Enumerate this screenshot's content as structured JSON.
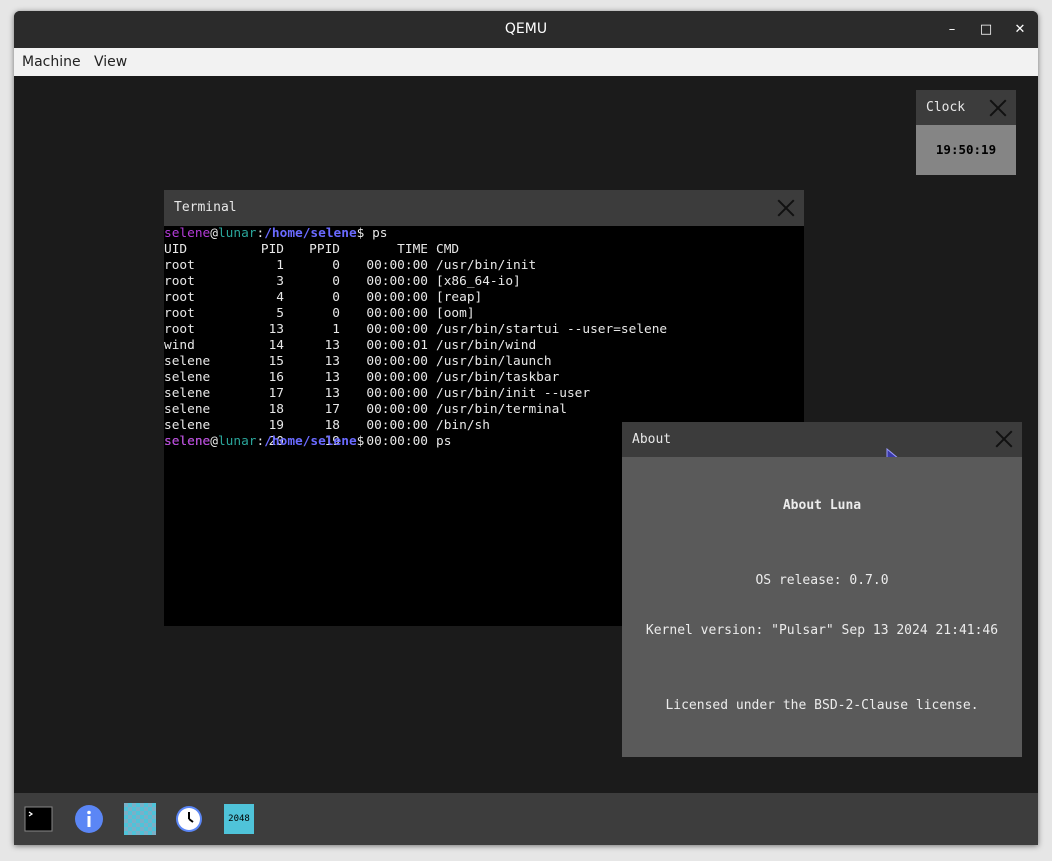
{
  "window": {
    "title": "QEMU",
    "minimize_label": "–",
    "maximize_label": "□",
    "close_label": "✕"
  },
  "menubar": {
    "items": [
      "Machine",
      "View"
    ]
  },
  "clock": {
    "title": "Clock",
    "time": "19:50:19"
  },
  "terminal": {
    "title": "Terminal",
    "prompt": {
      "user": "selene",
      "at": "@",
      "host": "lunar",
      "colon": ":",
      "path": "/home/selene",
      "symbol": "$"
    },
    "command": " ps",
    "columns": [
      "UID",
      "PID",
      "PPID",
      "TIME",
      "CMD"
    ],
    "rows": [
      [
        "root",
        "1",
        "0",
        "00:00:00",
        "/usr/bin/init"
      ],
      [
        "root",
        "3",
        "0",
        "00:00:00",
        "[x86_64-io]"
      ],
      [
        "root",
        "4",
        "0",
        "00:00:00",
        "[reap]"
      ],
      [
        "root",
        "5",
        "0",
        "00:00:00",
        "[oom]"
      ],
      [
        "root",
        "13",
        "1",
        "00:00:00",
        "/usr/bin/startui --user=selene"
      ],
      [
        "wind",
        "14",
        "13",
        "00:00:01",
        "/usr/bin/wind"
      ],
      [
        "selene",
        "15",
        "13",
        "00:00:00",
        "/usr/bin/launch"
      ],
      [
        "selene",
        "16",
        "13",
        "00:00:00",
        "/usr/bin/taskbar"
      ],
      [
        "selene",
        "17",
        "13",
        "00:00:00",
        "/usr/bin/init --user"
      ],
      [
        "selene",
        "18",
        "17",
        "00:00:00",
        "/usr/bin/terminal"
      ],
      [
        "selene",
        "19",
        "18",
        "00:00:00",
        "/bin/sh"
      ],
      [
        "selene",
        "20",
        "19",
        "00:00:00",
        "ps"
      ]
    ]
  },
  "about": {
    "title": "About",
    "heading": "About Luna",
    "release": "OS release: 0.7.0",
    "kernel": "Kernel version: \"Pulsar\" Sep 13 2024 21:41:46",
    "license": "Licensed under the BSD-2-Clause license."
  },
  "taskbar": {
    "items": [
      {
        "icon": "terminal-icon"
      },
      {
        "icon": "info-icon"
      },
      {
        "icon": "checkerboard-icon"
      },
      {
        "icon": "clock-icon"
      },
      {
        "icon": "game-2048-icon",
        "label": "2048"
      }
    ]
  },
  "colors": {
    "prompt_user": "#b33cd9",
    "prompt_host": "#2aa59a",
    "prompt_path": "#6a6aff",
    "accent_blue": "#5b86f5",
    "game_teal": "#4fc3d9"
  }
}
